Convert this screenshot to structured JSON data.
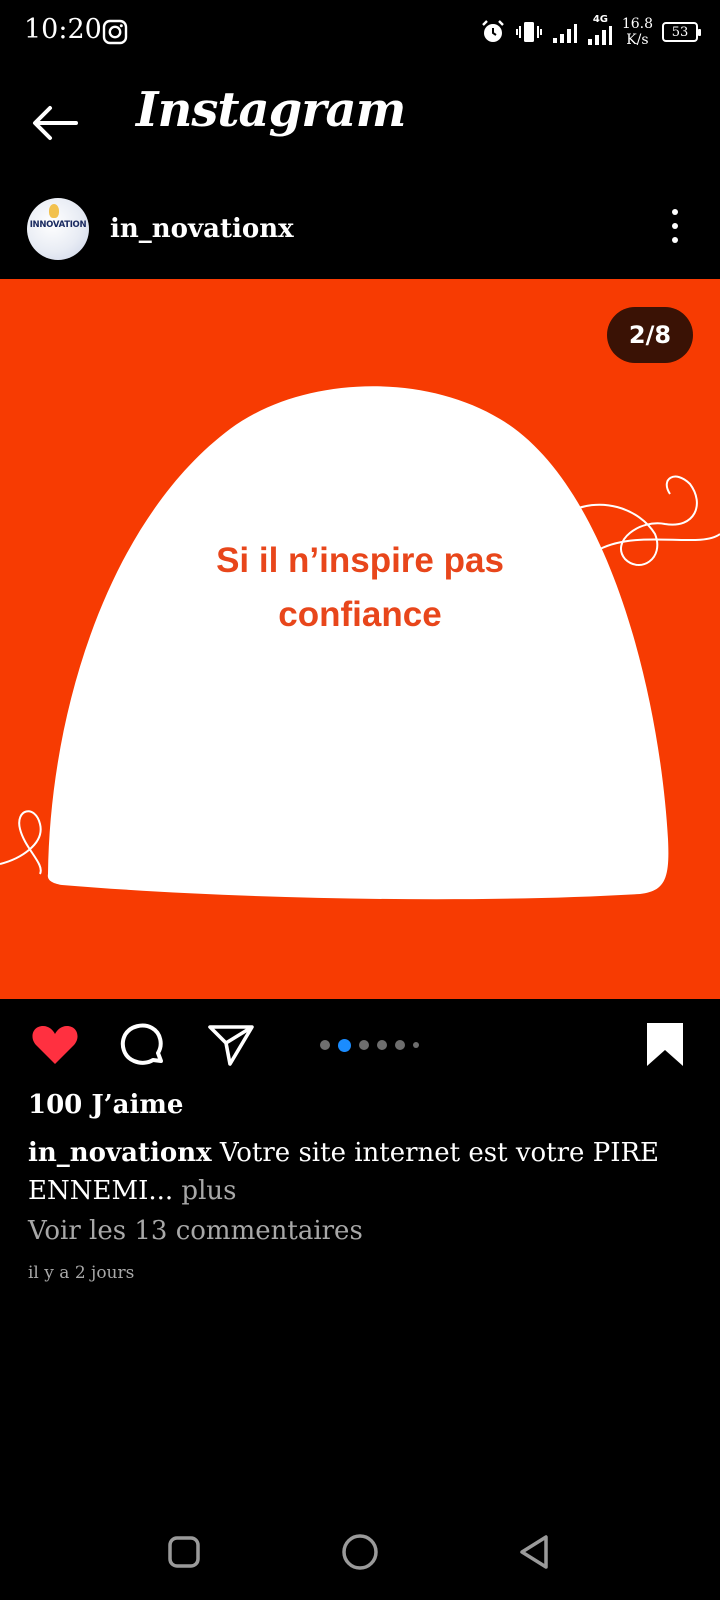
{
  "status_bar": {
    "time": "10:20",
    "network": "4G",
    "speed_value": "16.8",
    "speed_unit": "K/s",
    "battery": "53"
  },
  "header": {
    "title": "Instagram"
  },
  "post": {
    "username": "in_novationx",
    "avatar_text": "INNOVATION",
    "counter": "2/8",
    "slide_text": "Si il n’inspire pas confiance",
    "carousel": {
      "total_dots": 6,
      "active_index": 1
    },
    "likes": "100 J’aime",
    "caption_user": "in_novationx",
    "caption_text": "Votre site internet est votre PIRE ENNEMI...",
    "caption_more": "plus",
    "comments_link": "Voir les 13 commentaires",
    "timestamp": "il y a 2 jours"
  },
  "icons": {
    "like": "heart-icon",
    "comment": "comment-icon",
    "share": "send-icon",
    "save": "bookmark-icon"
  },
  "colors": {
    "slide_bg": "#f73b02",
    "slide_text": "#e8461b",
    "like": "#ff3040",
    "active_dot": "#1a8cff"
  }
}
